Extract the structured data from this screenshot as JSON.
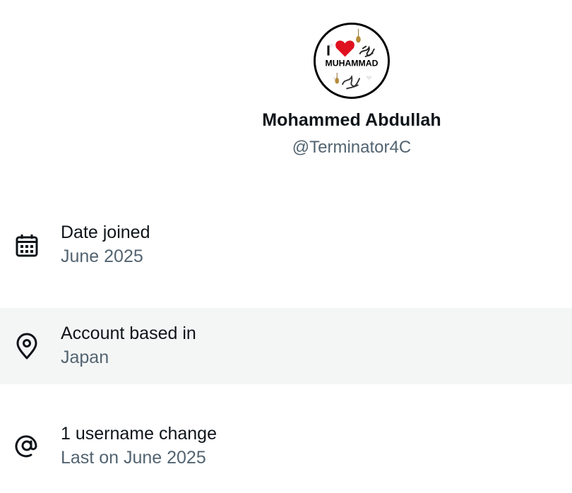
{
  "profile": {
    "display_name": "Mohammed Abdullah",
    "handle": "@Terminator4C",
    "avatar": {
      "icon": "avatar-image",
      "text_top": "I",
      "text_main": "MUHAMMAD"
    }
  },
  "about": {
    "items": [
      {
        "icon": "calendar-icon",
        "label": "Date joined",
        "value": "June 2025"
      },
      {
        "icon": "location-pin-icon",
        "label": "Account based in",
        "value": "Japan"
      },
      {
        "icon": "at-sign-icon",
        "label": "1 username change",
        "value": "Last on June 2025"
      }
    ]
  },
  "colors": {
    "primary_text": "#0f1419",
    "secondary_text": "#536471",
    "highlight_row": "#f4f6f6",
    "heart": "#e0111f"
  }
}
